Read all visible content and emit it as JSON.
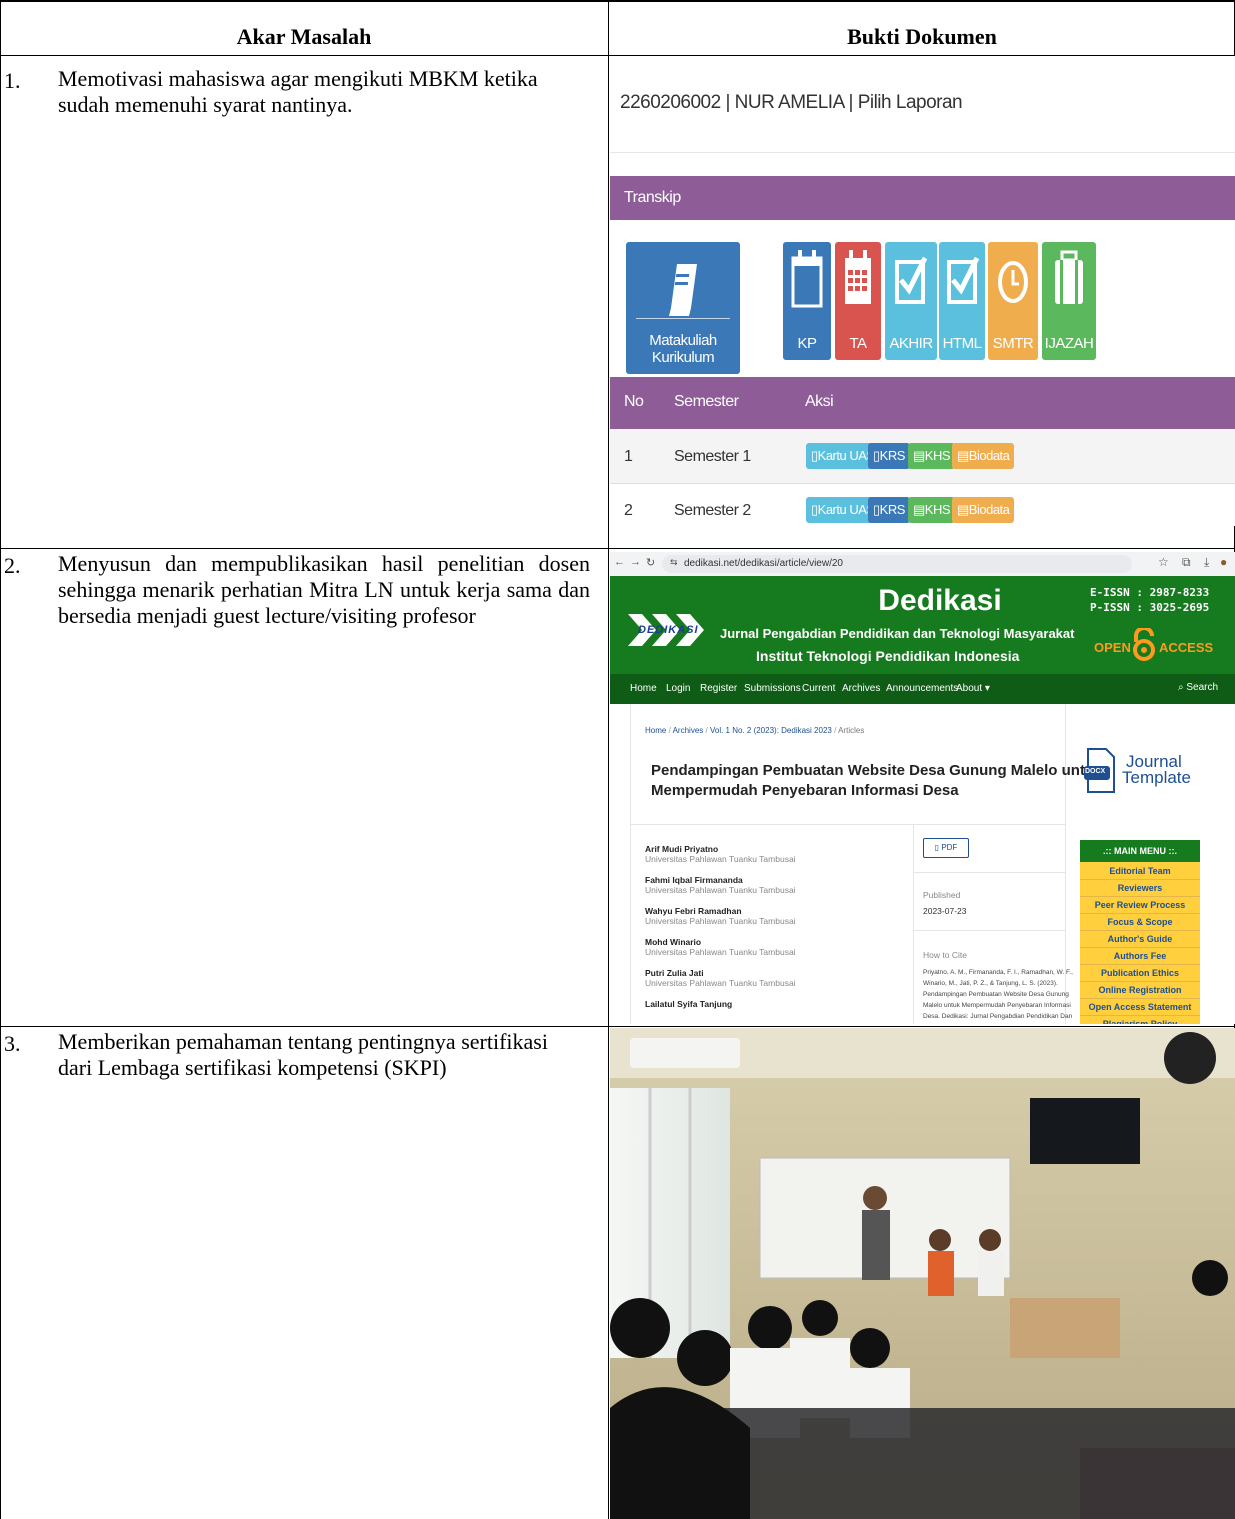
{
  "table": {
    "headers": [
      "Akar Masalah",
      "Bukti Dokumen"
    ],
    "rows": [
      {
        "no": "1.",
        "text": "Memotivasi mahasiswa agar mengikuti MBKM ketika sudah memenuhi syarat nantinya."
      },
      {
        "no": "2.",
        "text": "Menyusun dan mempublikasikan hasil penelitian dosen sehingga menarik perhatian Mitra LN untuk kerja sama dan bersedia menjadi guest lecture/visiting profesor"
      },
      {
        "no": "3.",
        "text": "Memberikan pemahaman tentang pentingnya sertifikasi dari Lembaga sertifikasi kompetensi (SKPI)"
      }
    ]
  },
  "shot1": {
    "heading": "2260206002 | NUR AMELIA | Pilih Laporan",
    "section": "Transkip",
    "tiles": [
      {
        "label": "Matakuliah Kurikulum",
        "color": "#3a78b8",
        "icon": "book-icon"
      },
      {
        "label": "KP",
        "color": "#3a78b8",
        "icon": "calendar-icon"
      },
      {
        "label": "TA",
        "color": "#d9534f",
        "icon": "calendar-grid-icon"
      },
      {
        "label": "AKHIR",
        "color": "#5bc0de",
        "icon": "checkbox-icon"
      },
      {
        "label": "HTML",
        "color": "#5bc0de",
        "icon": "checkbox-icon"
      },
      {
        "label": "SMTR",
        "color": "#f0ad4e",
        "icon": "clock-icon"
      },
      {
        "label": "IJAZAH",
        "color": "#5cb85c",
        "icon": "suitcase-icon"
      }
    ],
    "table_headers": [
      "No",
      "Semester",
      "Aksi"
    ],
    "rows": [
      {
        "no": "1",
        "semester": "Semester 1"
      },
      {
        "no": "2",
        "semester": "Semester 2"
      }
    ],
    "actions": [
      "Kartu UAS",
      "KRS",
      "KHS",
      "Biodata"
    ]
  },
  "shot2": {
    "url": "dedikasi.net/dedikasi/article/view/20",
    "logo_text": "DEDIKASI",
    "journal_title": "Dedikasi",
    "journal_subtitle": "Jurnal Pengabdian Pendidikan dan Teknologi Masyarakat",
    "institution": "Institut Teknologi Pendidikan Indonesia",
    "eissn": "E-ISSN : 2987-8233",
    "pissn": "P-ISSN : 3025-2695",
    "open_left": "OPEN",
    "open_right": "ACCESS",
    "nav": [
      "Home",
      "Login",
      "Register",
      "Submissions",
      "Current",
      "Archives",
      "Announcements",
      "About ▾"
    ],
    "search": "Search",
    "breadcrumb": [
      "Home",
      "Archives",
      "Vol. 1 No. 2 (2023): Dedikasi 2023",
      "Articles"
    ],
    "article_title_1": "Pendampingan Pembuatan Website Desa Gunung Malelo untuk",
    "article_title_2": "Mempermudah Penyebaran Informasi Desa",
    "authors": [
      {
        "name": "Arif Mudi Priyatno",
        "aff": "Universitas Pahlawan Tuanku Tambusai"
      },
      {
        "name": "Fahmi Iqbal Firmananda",
        "aff": "Universitas Pahlawan Tuanku Tambusai"
      },
      {
        "name": "Wahyu Febri Ramadhan",
        "aff": "Universitas Pahlawan Tuanku Tambusai"
      },
      {
        "name": "Mohd Winario",
        "aff": "Universitas Pahlawan Tuanku Tambusai"
      },
      {
        "name": "Putri Zulia Jati",
        "aff": "Universitas Pahlawan Tuanku Tambusai"
      },
      {
        "name": "Lailatul Syifa Tanjung",
        "aff": ""
      }
    ],
    "pdf": "PDF",
    "published_label": "Published",
    "published_date": "2023-07-23",
    "cite_label": "How to Cite",
    "cite_text_1": "Priyatno, A. M., Firmananda, F. I., Ramadhan, W. F.,",
    "cite_text_2": "Winario, M., Jati, P. Z., & Tanjung, L. S. (2023).",
    "cite_text_3": "Pendampingan Pembuatan Website Desa Gunung",
    "cite_text_4": "Malelo untuk Mempermudah Penyebaran Informasi",
    "cite_text_5": "Desa. Dedikasi: Jurnal Pengabdian Pendidikan Dan",
    "docx": "DOCX",
    "template_1": "Journal",
    "template_2": "Template",
    "main_menu": ".:: MAIN MENU ::.",
    "menu": [
      "Editorial Team",
      "Reviewers",
      "Peer Review Process",
      "Focus & Scope",
      "Author's Guide",
      "Authors Fee",
      "Publication Ethics",
      "Online Registration",
      "Open Access Statement",
      "Plagiarism Policy"
    ]
  },
  "colors": {
    "purple": "#8e5d97",
    "green": "#167a1f",
    "menu_yellow": "#ffcf3d"
  }
}
